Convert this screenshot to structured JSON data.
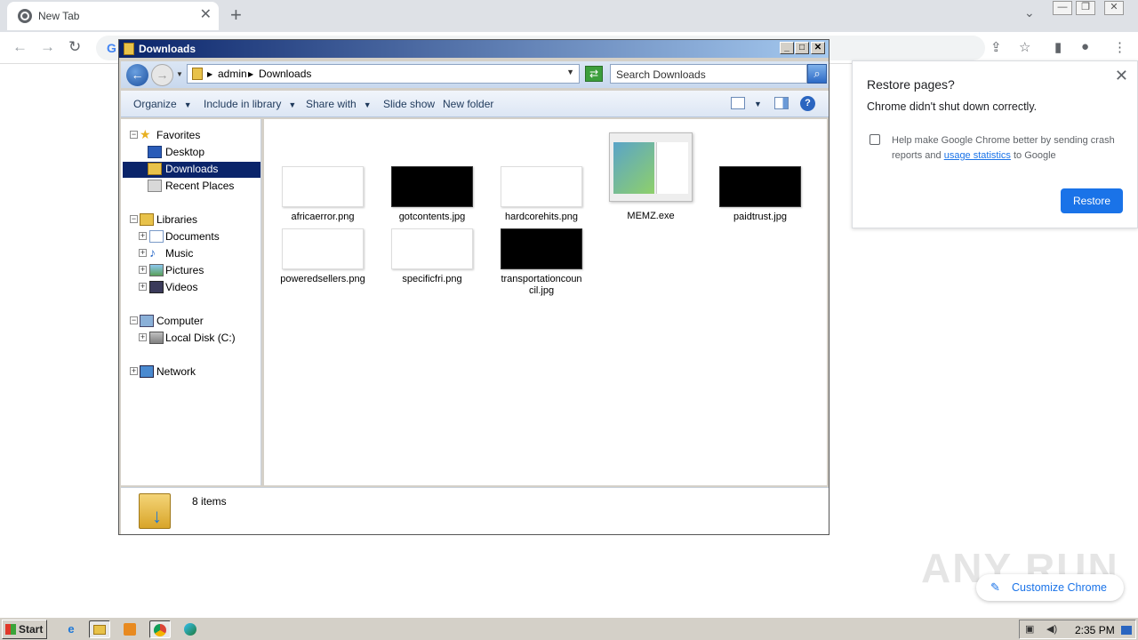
{
  "browser": {
    "tab_title": "New Tab",
    "tab_close": "✕",
    "new_tab": "+",
    "dropdown": "⌄",
    "window_buttons": [
      "—",
      "❐",
      "✕"
    ],
    "nav": {
      "back": "←",
      "forward": "→",
      "reload": "↻"
    },
    "omnibox_logo": "G",
    "toolbar_icons": [
      "share-icon",
      "star-icon",
      "side-panel-icon",
      "profile-icon",
      "menu-icon"
    ]
  },
  "restore_popup": {
    "title": "Restore pages?",
    "message": "Chrome didn't shut down correctly.",
    "close": "✕",
    "checkbox_text_before": "Help make Google Chrome better by sending crash reports and ",
    "checkbox_link": "usage statistics",
    "checkbox_text_after": " to Google",
    "button": "Restore"
  },
  "explorer": {
    "title": "Downloads",
    "caption_buttons": [
      "_",
      "□",
      "✕"
    ],
    "address": {
      "segments": [
        "admin",
        "Downloads"
      ]
    },
    "search_placeholder": "Search Downloads",
    "commands": [
      {
        "label": "Organize",
        "dropdown": true
      },
      {
        "label": "Include in library",
        "dropdown": true
      },
      {
        "label": "Share with",
        "dropdown": true
      },
      {
        "label": "Slide show",
        "dropdown": false
      },
      {
        "label": "New folder",
        "dropdown": false
      }
    ],
    "help": "?",
    "nav_tree": [
      {
        "label": "Favorites",
        "level": 0,
        "expander": "−",
        "icon": "star-icon"
      },
      {
        "label": "Desktop",
        "level": 1,
        "icon": "desktop-icon"
      },
      {
        "label": "Downloads",
        "level": 1,
        "icon": "downloads-folder-icon",
        "selected": true
      },
      {
        "label": "Recent Places",
        "level": 1,
        "icon": "recent-places-icon"
      },
      {
        "label": "Libraries",
        "level": 0,
        "expander": "−",
        "icon": "libraries-icon"
      },
      {
        "label": "Documents",
        "level": 1,
        "expander": "+",
        "icon": "documents-icon"
      },
      {
        "label": "Music",
        "level": 1,
        "expander": "+",
        "icon": "music-icon"
      },
      {
        "label": "Pictures",
        "level": 1,
        "expander": "+",
        "icon": "pictures-icon"
      },
      {
        "label": "Videos",
        "level": 1,
        "expander": "+",
        "icon": "videos-icon"
      },
      {
        "label": "Computer",
        "level": 0,
        "expander": "−",
        "icon": "computer-icon"
      },
      {
        "label": "Local Disk (C:)",
        "level": 1,
        "expander": "+",
        "icon": "disk-icon"
      },
      {
        "label": "Network",
        "level": 0,
        "expander": "+",
        "icon": "network-icon"
      }
    ],
    "files": [
      {
        "name": "africaerror.png",
        "thumb": "light"
      },
      {
        "name": "gotcontents.jpg",
        "thumb": "dark"
      },
      {
        "name": "hardcorehits.png",
        "thumb": "light"
      },
      {
        "name": "MEMZ.exe",
        "thumb": "exe"
      },
      {
        "name": "paidtrust.jpg",
        "thumb": "dark"
      },
      {
        "name": "poweredsellers.png",
        "thumb": "light"
      },
      {
        "name": "specificfri.png",
        "thumb": "light"
      },
      {
        "name": "transportationcouncil.jpg",
        "thumb": "dark"
      }
    ],
    "status": "8 items"
  },
  "customize_chrome": "Customize Chrome",
  "watermark": "ANY RUN",
  "taskbar": {
    "start": "Start",
    "apps": [
      "ie-icon",
      "explorer-icon",
      "media-player-icon",
      "chrome-icon",
      "edge-icon"
    ],
    "clock": "2:35 PM"
  },
  "colors": {
    "chrome_blue": "#1a73e8",
    "xp_title": "#0a246a",
    "selection": "#0a246a"
  }
}
